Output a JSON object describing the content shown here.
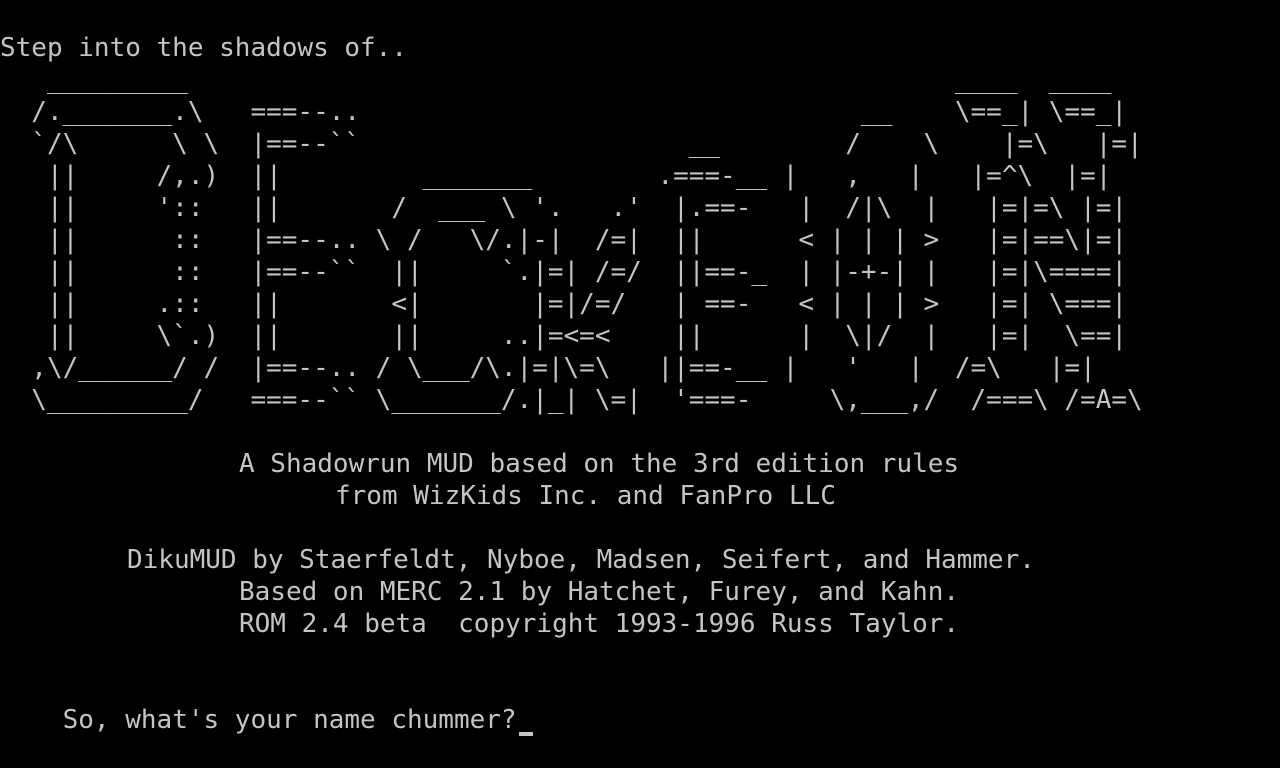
{
  "terminal": {
    "intro": "Step into the shadows of..",
    "art_lines": [
      "   _________                                                 ____  ____",
      "  /._______.\\   ===--..                                __    \\==_| \\==_|",
      "  `/\\      \\ \\  |==--``                     __        /    \\    |=\\   |=|",
      "   ||     /,.)  ||         _______        .===-__ |   ,   |   |=^\\  |=|",
      "   ||     '::   ||       /  ___ \\ '.   .'  |.==-   |  /|\\  |   |=|=\\ |=|",
      "   ||      ::   |==--.. \\ /   \\/.|-|  /=|  ||      < | | | >   |=|==\\|=|",
      "   ||      ::   |==--``  ||     `.|=| /=/  ||==-_  | |-+-| |   |=|\\====|",
      "   ||     .::   ||       <|       |=|/=/   | ==-   < | | | >   |=| \\===|",
      "   ||     \\`.)  ||       ||     ..|=<=<    ||      |  \\|/  |   |=|  \\==|",
      "  ,\\/______/ /  |==--.. / \\___/\\.|=|\\=\\   ||==-__ |   '   |  /=\\   |=|",
      "  \\_________/   ===--`` \\_______/.|_| \\=|  '===-     \\,___,/  /===\\ /=A=\\"
    ],
    "subtitle_1": "A Shadowrun MUD based on the 3rd edition rules",
    "subtitle_2": "from WizKids Inc. and FanPro LLC",
    "credits_1": "DikuMUD by Staerfeldt, Nyboe, Madsen, Seifert, and Hammer.",
    "credits_2": "Based on MERC 2.1 by Hatchet, Furey, and Kahn.",
    "credits_3": "ROM 2.4 beta  copyright 1993-1996 Russ Taylor.",
    "prompt": "So, what's your name chummer?"
  }
}
